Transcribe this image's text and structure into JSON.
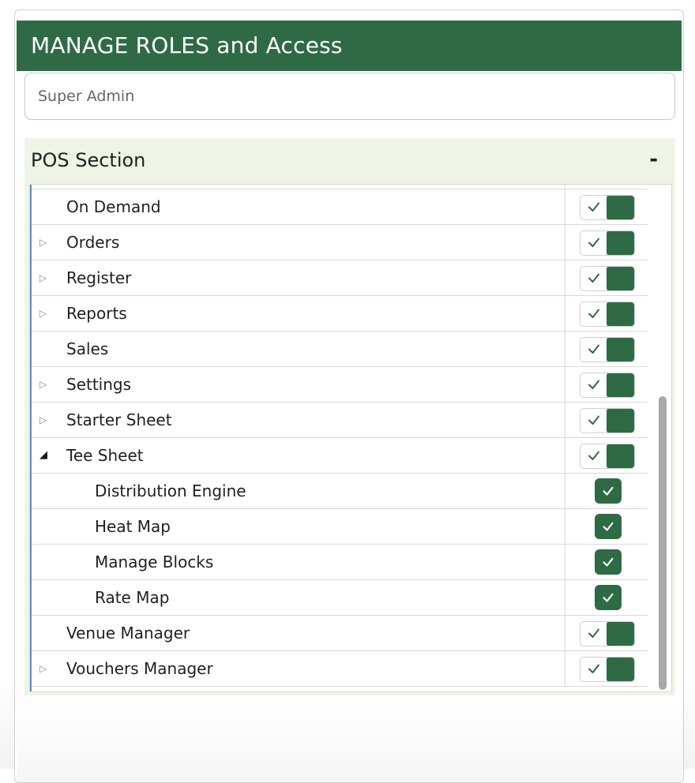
{
  "panel": {
    "title": "MANAGE ROLES and Access",
    "role_input": {
      "value": "",
      "placeholder": "Super Admin"
    }
  },
  "section": {
    "title": "POS Section",
    "toggle_symbol": "-",
    "colors": {
      "accent": "#2e6b45",
      "section_bg": "#eef5e6",
      "tree_accent": "#5b8dd1"
    },
    "items": [
      {
        "label": "On Demand",
        "level": 1,
        "expander": "none",
        "control": "toggle",
        "checked": true
      },
      {
        "label": "Orders",
        "level": 1,
        "expander": "collapsed",
        "control": "toggle",
        "checked": true
      },
      {
        "label": "Register",
        "level": 1,
        "expander": "collapsed",
        "control": "toggle",
        "checked": true
      },
      {
        "label": "Reports",
        "level": 1,
        "expander": "collapsed",
        "control": "toggle",
        "checked": true
      },
      {
        "label": "Sales",
        "level": 1,
        "expander": "none",
        "control": "toggle",
        "checked": true
      },
      {
        "label": "Settings",
        "level": 1,
        "expander": "collapsed",
        "control": "toggle",
        "checked": true
      },
      {
        "label": "Starter Sheet",
        "level": 1,
        "expander": "collapsed",
        "control": "toggle",
        "checked": true
      },
      {
        "label": "Tee Sheet",
        "level": 1,
        "expander": "expanded",
        "control": "toggle",
        "checked": true
      },
      {
        "label": "Distribution Engine",
        "level": 2,
        "expander": "none",
        "control": "checkbox",
        "checked": true
      },
      {
        "label": "Heat Map",
        "level": 2,
        "expander": "none",
        "control": "checkbox",
        "checked": true
      },
      {
        "label": "Manage Blocks",
        "level": 2,
        "expander": "none",
        "control": "checkbox",
        "checked": true
      },
      {
        "label": "Rate Map",
        "level": 2,
        "expander": "none",
        "control": "checkbox",
        "checked": true
      },
      {
        "label": "Venue Manager",
        "level": 1,
        "expander": "none",
        "control": "toggle",
        "checked": true
      },
      {
        "label": "Vouchers Manager",
        "level": 1,
        "expander": "collapsed",
        "control": "toggle",
        "checked": true
      }
    ]
  },
  "icons": {
    "collapsed": "triangle-right-icon",
    "expanded": "triangle-down-icon",
    "check": "check-icon"
  }
}
